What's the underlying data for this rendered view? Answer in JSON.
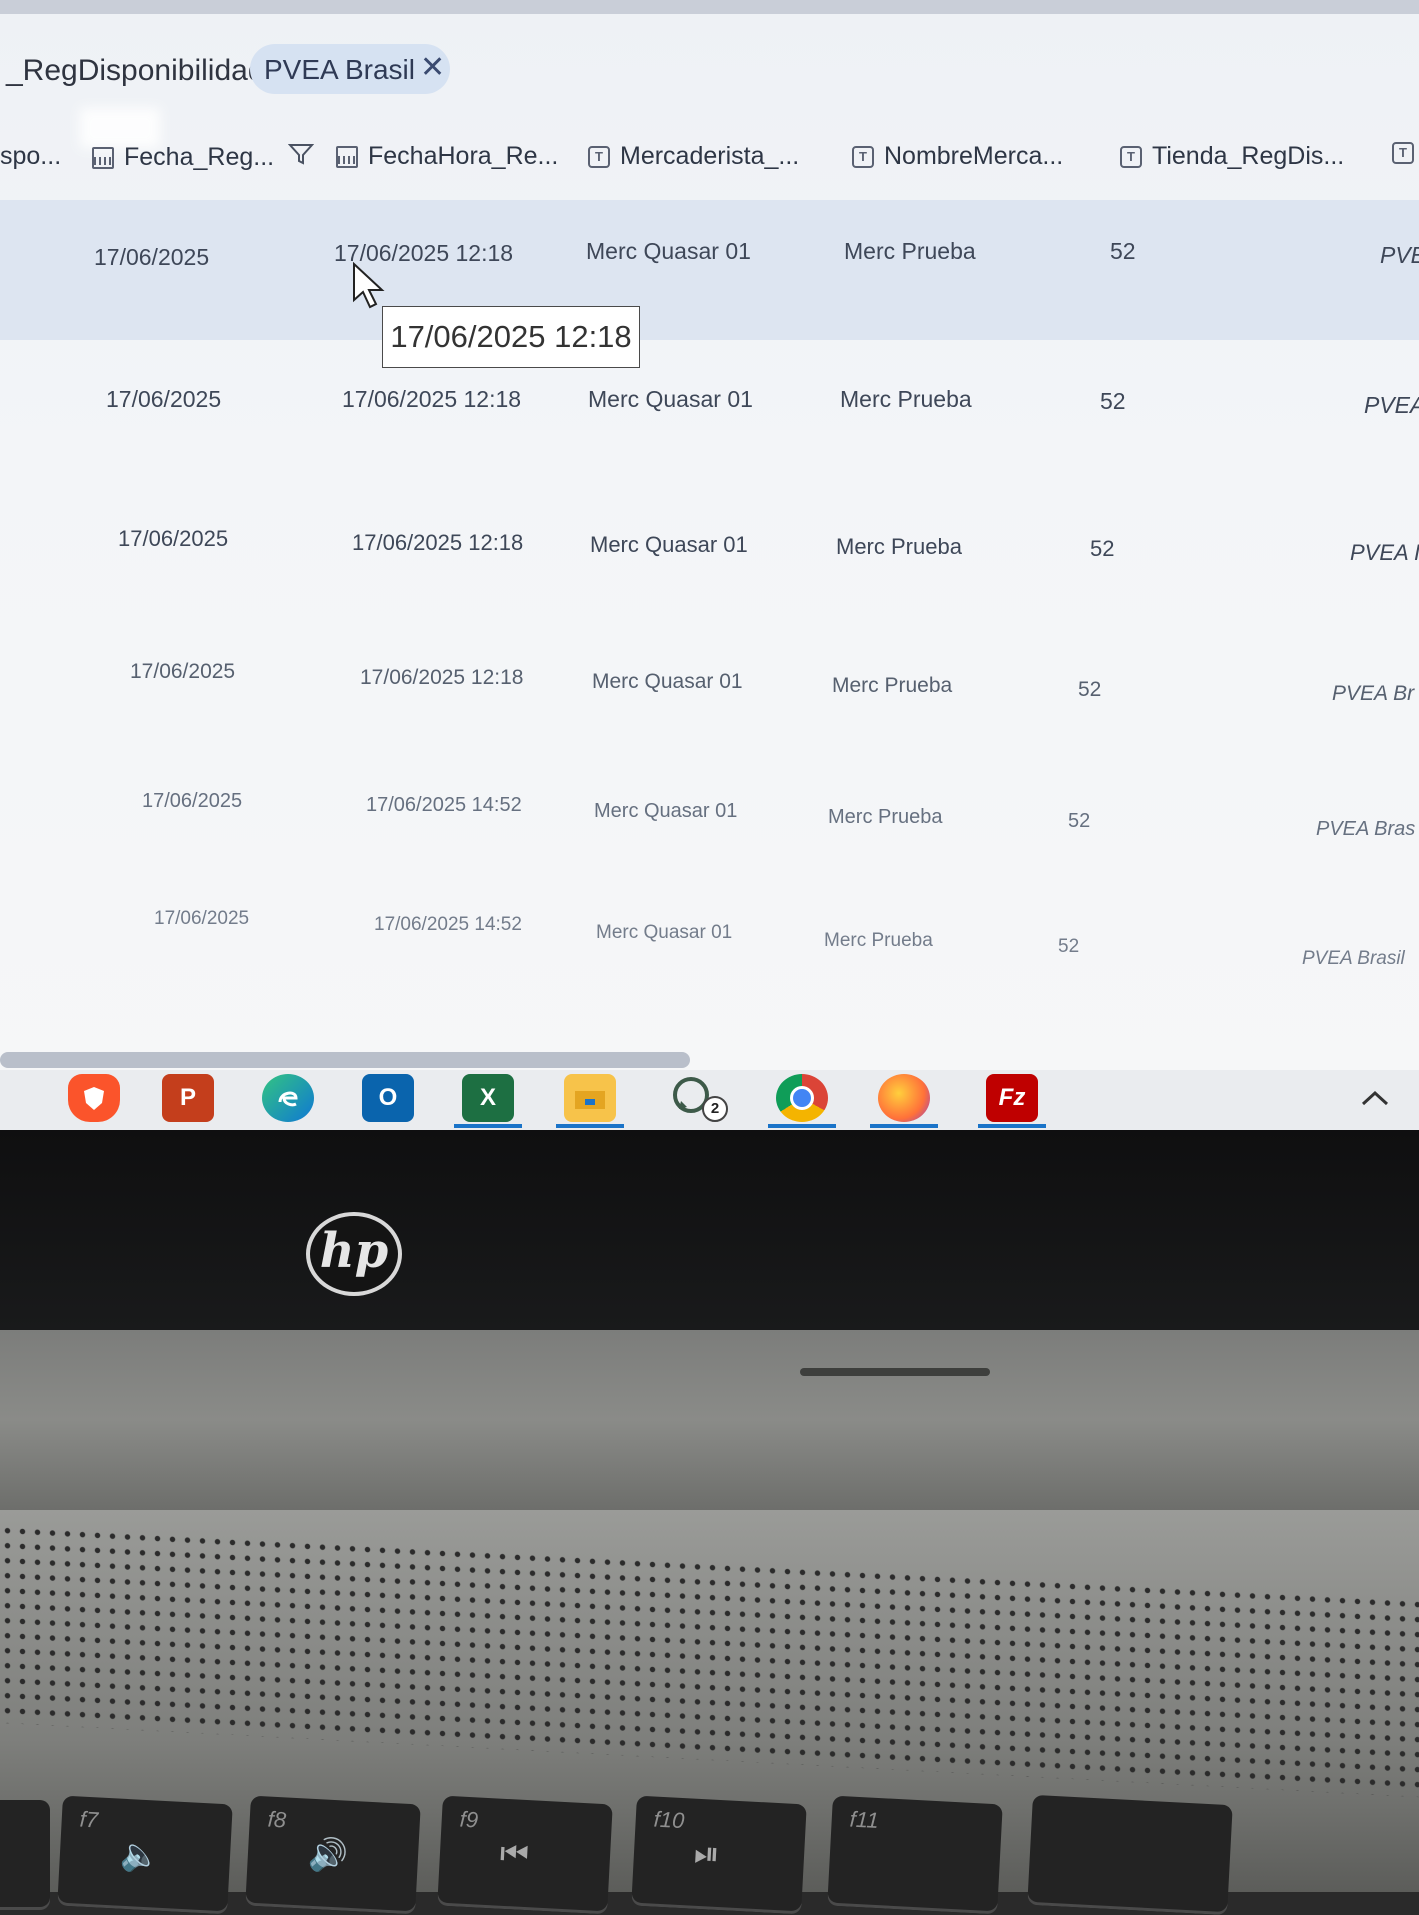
{
  "filter": {
    "label": "_RegDisponibilidad:",
    "chip": "PVEA Brasil",
    "chip_close": "✕"
  },
  "columns": {
    "c0": "spo...",
    "c1": "Fecha_Reg...",
    "c2": "FechaHora_Re...",
    "c3": "Mercaderista_...",
    "c4": "NombreMerca...",
    "c5": "Tienda_RegDis..."
  },
  "rows": [
    {
      "fecha": "17/06/2025",
      "fechahora": "17/06/2025 12:18",
      "merc": "Merc Quasar 01",
      "nombre": "Merc Prueba",
      "tienda": "52",
      "extra": "PVE"
    },
    {
      "fecha": "17/06/2025",
      "fechahora": "17/06/2025 12:18",
      "merc": "Merc Quasar 01",
      "nombre": "Merc Prueba",
      "tienda": "52",
      "extra": "PVEA"
    },
    {
      "fecha": "17/06/2025",
      "fechahora": "17/06/2025 12:18",
      "merc": "Merc Quasar 01",
      "nombre": "Merc Prueba",
      "tienda": "52",
      "extra": "PVEA I"
    },
    {
      "fecha": "17/06/2025",
      "fechahora": "17/06/2025 12:18",
      "merc": "Merc Quasar 01",
      "nombre": "Merc Prueba",
      "tienda": "52",
      "extra": "PVEA Br"
    },
    {
      "fecha": "17/06/2025",
      "fechahora": "17/06/2025 14:52",
      "merc": "Merc Quasar 01",
      "nombre": "Merc Prueba",
      "tienda": "52",
      "extra": "PVEA Bras"
    },
    {
      "fecha": "17/06/2025",
      "fechahora": "17/06/2025 14:52",
      "merc": "Merc Quasar 01",
      "nombre": "Merc Prueba",
      "tienda": "52",
      "extra": "PVEA Brasil"
    }
  ],
  "tooltip": "17/06/2025 12:18",
  "taskbar": {
    "whatsapp_badge": "2",
    "apps": [
      "brave-icon",
      "powerpoint-icon",
      "edge-icon",
      "outlook-icon",
      "excel-icon",
      "file-explorer-icon",
      "whatsapp-icon",
      "chrome-icon",
      "firefox-icon",
      "filezilla-icon"
    ]
  },
  "brand_logo": "hp",
  "keys": {
    "f7": "f7",
    "f8": "f8",
    "f9": "f9",
    "f10": "f10",
    "f11": "f11"
  },
  "colors": {
    "selected_row": "#dde5f1",
    "chip": "#d6e2f2",
    "taskbar_underline": "#1a73c8"
  }
}
